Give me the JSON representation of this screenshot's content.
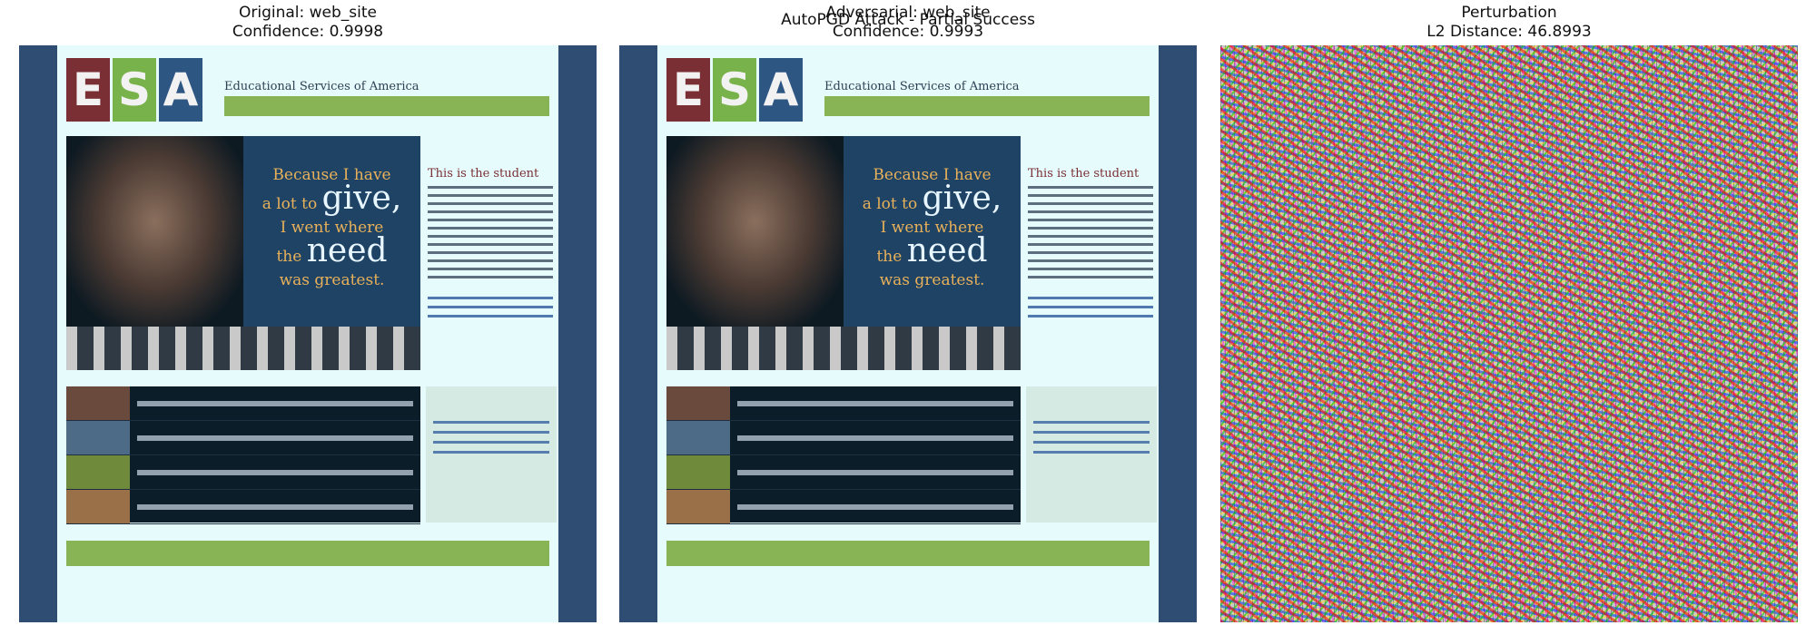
{
  "figure": {
    "suptitle": "AutoPGD Attack - Partial Success"
  },
  "panels": [
    {
      "title_line1": "Original: web_site",
      "title_line2": "Confidence: 0.9998"
    },
    {
      "title_line1": "Adversarial: web_site",
      "title_line2": "Confidence: 0.9993"
    },
    {
      "title_line1": "Perturbation",
      "title_line2": "L2 Distance: 46.8993"
    }
  ],
  "site": {
    "logo_letters": [
      "E",
      "S",
      "A"
    ],
    "name": "Educational Services of America",
    "hero_quote_small_1": "Because I have",
    "hero_quote_small_2": "a lot to",
    "hero_quote_big_1": "give,",
    "hero_quote_small_3": "I went where",
    "hero_quote_small_4": "the",
    "hero_quote_big_2": "need",
    "hero_quote_small_5": "was greatest.",
    "right_heading": "This is the student"
  },
  "colors": {
    "site_sidebar": "#2f4d73",
    "site_background": "#e6fbfb",
    "nav_green": "#88b455",
    "logo_red": "#7a2f35",
    "logo_green": "#78b24a",
    "logo_blue": "#2e5683"
  }
}
